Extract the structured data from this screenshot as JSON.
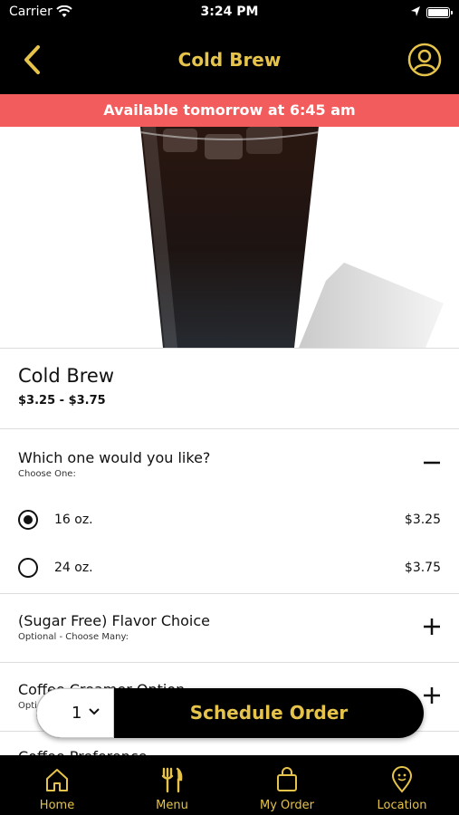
{
  "status": {
    "carrier": "Carrier",
    "time": "3:24 PM"
  },
  "nav": {
    "title": "Cold Brew"
  },
  "banner": "Available tomorrow at 6:45 am",
  "product": {
    "name": "Cold Brew",
    "price_range": "$3.25 - $3.75"
  },
  "size_section": {
    "title": "Which one would you like?",
    "subtitle": "Choose One:",
    "options": [
      {
        "label": "16 oz.",
        "price": "$3.25",
        "selected": true
      },
      {
        "label": "24 oz.",
        "price": "$3.75",
        "selected": false
      }
    ]
  },
  "flavor_section": {
    "title": "(Sugar Free) Flavor Choice",
    "subtitle": "Optional - Choose Many:"
  },
  "creamer_section": {
    "title": "Coffee Creamer Option",
    "subtitle": "Optional - Choose Many:"
  },
  "next_section": {
    "title": "Coffee Preference"
  },
  "order_bar": {
    "quantity": "1",
    "button": "Schedule Order"
  },
  "tabs": [
    {
      "label": "Home",
      "icon": "home-icon"
    },
    {
      "label": "Menu",
      "icon": "fork-knife-icon"
    },
    {
      "label": "My Order",
      "icon": "shopping-bag-icon"
    },
    {
      "label": "Location",
      "icon": "location-pin-icon"
    }
  ],
  "colors": {
    "accent": "#e6c34a",
    "banner": "#f25c5c",
    "bar": "#000000"
  }
}
